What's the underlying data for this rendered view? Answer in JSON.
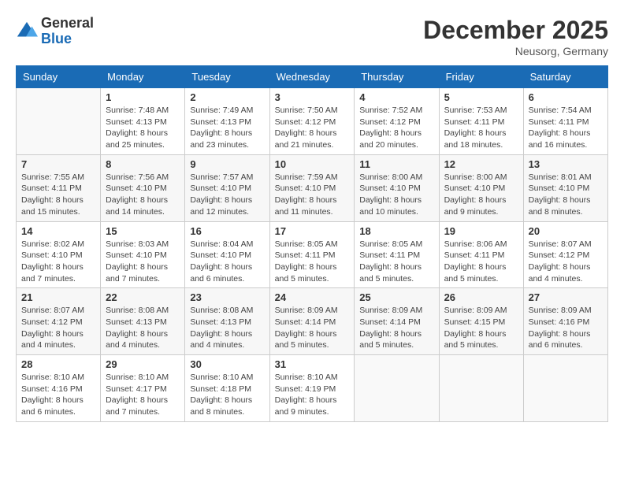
{
  "header": {
    "logo_general": "General",
    "logo_blue": "Blue",
    "month": "December 2025",
    "location": "Neusorg, Germany"
  },
  "weekdays": [
    "Sunday",
    "Monday",
    "Tuesday",
    "Wednesday",
    "Thursday",
    "Friday",
    "Saturday"
  ],
  "weeks": [
    [
      {
        "day": "",
        "info": ""
      },
      {
        "day": "1",
        "info": "Sunrise: 7:48 AM\nSunset: 4:13 PM\nDaylight: 8 hours\nand 25 minutes."
      },
      {
        "day": "2",
        "info": "Sunrise: 7:49 AM\nSunset: 4:13 PM\nDaylight: 8 hours\nand 23 minutes."
      },
      {
        "day": "3",
        "info": "Sunrise: 7:50 AM\nSunset: 4:12 PM\nDaylight: 8 hours\nand 21 minutes."
      },
      {
        "day": "4",
        "info": "Sunrise: 7:52 AM\nSunset: 4:12 PM\nDaylight: 8 hours\nand 20 minutes."
      },
      {
        "day": "5",
        "info": "Sunrise: 7:53 AM\nSunset: 4:11 PM\nDaylight: 8 hours\nand 18 minutes."
      },
      {
        "day": "6",
        "info": "Sunrise: 7:54 AM\nSunset: 4:11 PM\nDaylight: 8 hours\nand 16 minutes."
      }
    ],
    [
      {
        "day": "7",
        "info": "Sunrise: 7:55 AM\nSunset: 4:11 PM\nDaylight: 8 hours\nand 15 minutes."
      },
      {
        "day": "8",
        "info": "Sunrise: 7:56 AM\nSunset: 4:10 PM\nDaylight: 8 hours\nand 14 minutes."
      },
      {
        "day": "9",
        "info": "Sunrise: 7:57 AM\nSunset: 4:10 PM\nDaylight: 8 hours\nand 12 minutes."
      },
      {
        "day": "10",
        "info": "Sunrise: 7:59 AM\nSunset: 4:10 PM\nDaylight: 8 hours\nand 11 minutes."
      },
      {
        "day": "11",
        "info": "Sunrise: 8:00 AM\nSunset: 4:10 PM\nDaylight: 8 hours\nand 10 minutes."
      },
      {
        "day": "12",
        "info": "Sunrise: 8:00 AM\nSunset: 4:10 PM\nDaylight: 8 hours\nand 9 minutes."
      },
      {
        "day": "13",
        "info": "Sunrise: 8:01 AM\nSunset: 4:10 PM\nDaylight: 8 hours\nand 8 minutes."
      }
    ],
    [
      {
        "day": "14",
        "info": "Sunrise: 8:02 AM\nSunset: 4:10 PM\nDaylight: 8 hours\nand 7 minutes."
      },
      {
        "day": "15",
        "info": "Sunrise: 8:03 AM\nSunset: 4:10 PM\nDaylight: 8 hours\nand 7 minutes."
      },
      {
        "day": "16",
        "info": "Sunrise: 8:04 AM\nSunset: 4:10 PM\nDaylight: 8 hours\nand 6 minutes."
      },
      {
        "day": "17",
        "info": "Sunrise: 8:05 AM\nSunset: 4:11 PM\nDaylight: 8 hours\nand 5 minutes."
      },
      {
        "day": "18",
        "info": "Sunrise: 8:05 AM\nSunset: 4:11 PM\nDaylight: 8 hours\nand 5 minutes."
      },
      {
        "day": "19",
        "info": "Sunrise: 8:06 AM\nSunset: 4:11 PM\nDaylight: 8 hours\nand 5 minutes."
      },
      {
        "day": "20",
        "info": "Sunrise: 8:07 AM\nSunset: 4:12 PM\nDaylight: 8 hours\nand 4 minutes."
      }
    ],
    [
      {
        "day": "21",
        "info": "Sunrise: 8:07 AM\nSunset: 4:12 PM\nDaylight: 8 hours\nand 4 minutes."
      },
      {
        "day": "22",
        "info": "Sunrise: 8:08 AM\nSunset: 4:13 PM\nDaylight: 8 hours\nand 4 minutes."
      },
      {
        "day": "23",
        "info": "Sunrise: 8:08 AM\nSunset: 4:13 PM\nDaylight: 8 hours\nand 4 minutes."
      },
      {
        "day": "24",
        "info": "Sunrise: 8:09 AM\nSunset: 4:14 PM\nDaylight: 8 hours\nand 5 minutes."
      },
      {
        "day": "25",
        "info": "Sunrise: 8:09 AM\nSunset: 4:14 PM\nDaylight: 8 hours\nand 5 minutes."
      },
      {
        "day": "26",
        "info": "Sunrise: 8:09 AM\nSunset: 4:15 PM\nDaylight: 8 hours\nand 5 minutes."
      },
      {
        "day": "27",
        "info": "Sunrise: 8:09 AM\nSunset: 4:16 PM\nDaylight: 8 hours\nand 6 minutes."
      }
    ],
    [
      {
        "day": "28",
        "info": "Sunrise: 8:10 AM\nSunset: 4:16 PM\nDaylight: 8 hours\nand 6 minutes."
      },
      {
        "day": "29",
        "info": "Sunrise: 8:10 AM\nSunset: 4:17 PM\nDaylight: 8 hours\nand 7 minutes."
      },
      {
        "day": "30",
        "info": "Sunrise: 8:10 AM\nSunset: 4:18 PM\nDaylight: 8 hours\nand 8 minutes."
      },
      {
        "day": "31",
        "info": "Sunrise: 8:10 AM\nSunset: 4:19 PM\nDaylight: 8 hours\nand 9 minutes."
      },
      {
        "day": "",
        "info": ""
      },
      {
        "day": "",
        "info": ""
      },
      {
        "day": "",
        "info": ""
      }
    ]
  ]
}
